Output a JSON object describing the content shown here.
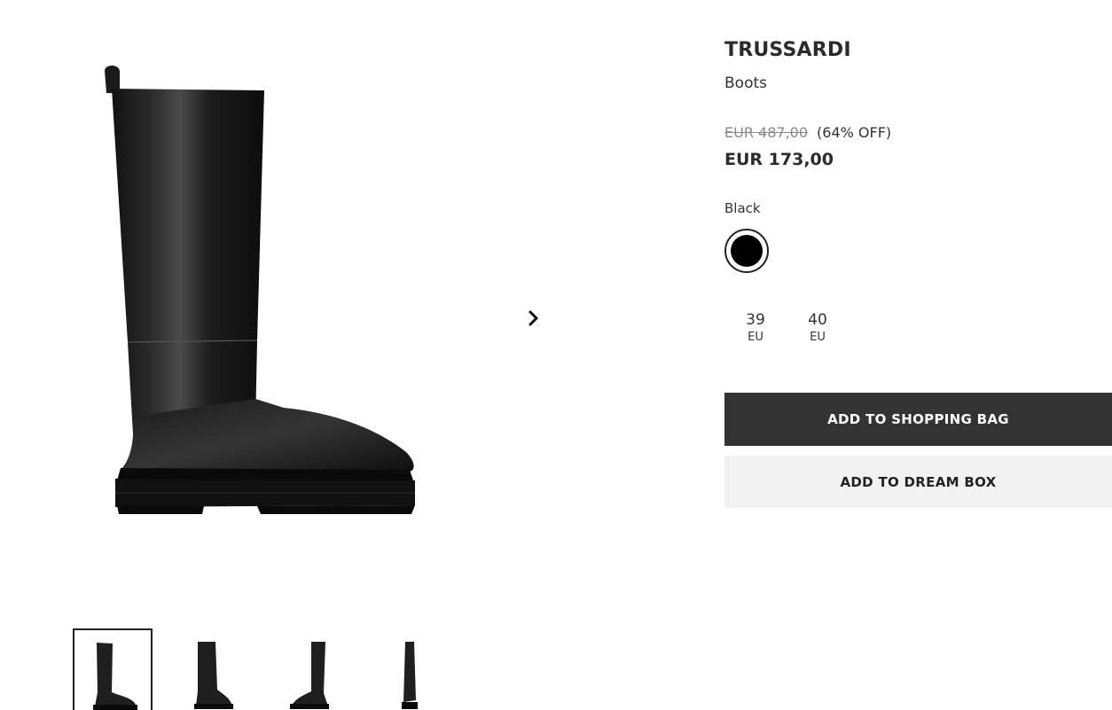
{
  "colors": {
    "primary_button_bg": "#333333",
    "secondary_button_bg": "#f2f2f2",
    "secondary_button_text": "#222222",
    "swatch_black": "#000000"
  },
  "gallery": {
    "next_icon": "chevron-right-icon",
    "thumbnails": [
      {
        "view": "side",
        "active": true
      },
      {
        "view": "front-angle",
        "active": false
      },
      {
        "view": "back",
        "active": false
      },
      {
        "view": "front",
        "active": false
      }
    ]
  },
  "product": {
    "brand": "TRUSSARDI",
    "name": "Boots",
    "original_price": "EUR 487,00",
    "discount": "(64% OFF)",
    "price": "EUR 173,00",
    "color_label": "Black"
  },
  "sizes": [
    {
      "value": "39",
      "unit": "EU"
    },
    {
      "value": "40",
      "unit": "EU"
    }
  ],
  "actions": {
    "add_to_bag": "ADD TO SHOPPING BAG",
    "add_to_dream_box": "ADD TO DREAM BOX"
  }
}
